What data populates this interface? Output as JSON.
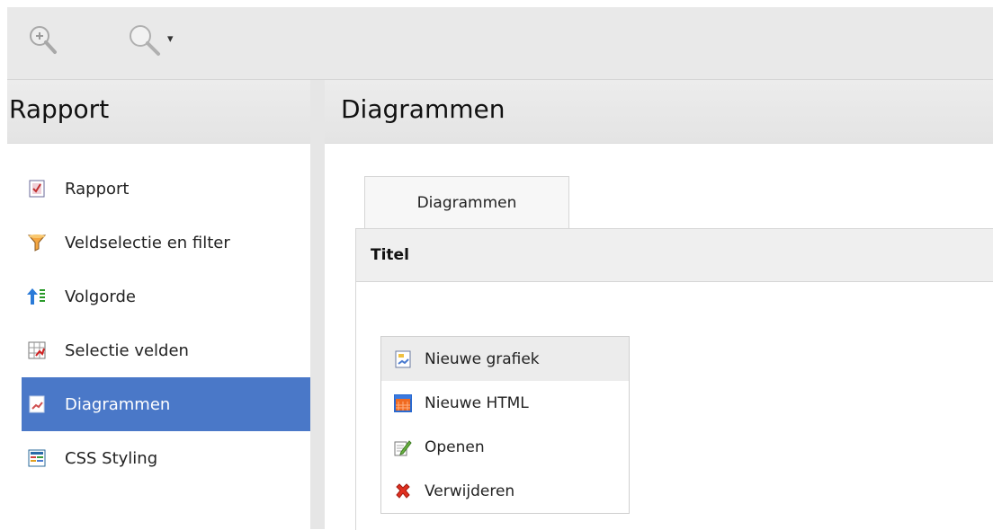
{
  "toolbar": {
    "zoom_icon": "zoom-in-icon",
    "search_icon": "search-icon",
    "dropdown_arrow": "▾"
  },
  "left_panel": {
    "title": "Rapport"
  },
  "right_panel": {
    "title": "Diagrammen"
  },
  "nav": {
    "items": [
      {
        "label": "Rapport",
        "icon": "report-icon"
      },
      {
        "label": "Veldselectie en filter",
        "icon": "filter-icon"
      },
      {
        "label": "Volgorde",
        "icon": "sort-order-icon"
      },
      {
        "label": "Selectie velden",
        "icon": "field-selection-icon"
      },
      {
        "label": "Diagrammen",
        "icon": "chart-icon",
        "active": true
      },
      {
        "label": "CSS Styling",
        "icon": "css-styling-icon"
      }
    ]
  },
  "tabs": [
    {
      "label": "Diagrammen"
    }
  ],
  "table": {
    "header": "Titel"
  },
  "context_menu": {
    "items": [
      {
        "label": "Nieuwe grafiek",
        "icon": "new-chart-icon"
      },
      {
        "label": "Nieuwe HTML",
        "icon": "new-html-icon"
      },
      {
        "label": "Openen",
        "icon": "open-edit-icon"
      },
      {
        "label": "Verwijderen",
        "icon": "delete-icon"
      }
    ]
  },
  "colors": {
    "active_nav": "#4a78c8",
    "header_bg": "#e8e8e8"
  }
}
